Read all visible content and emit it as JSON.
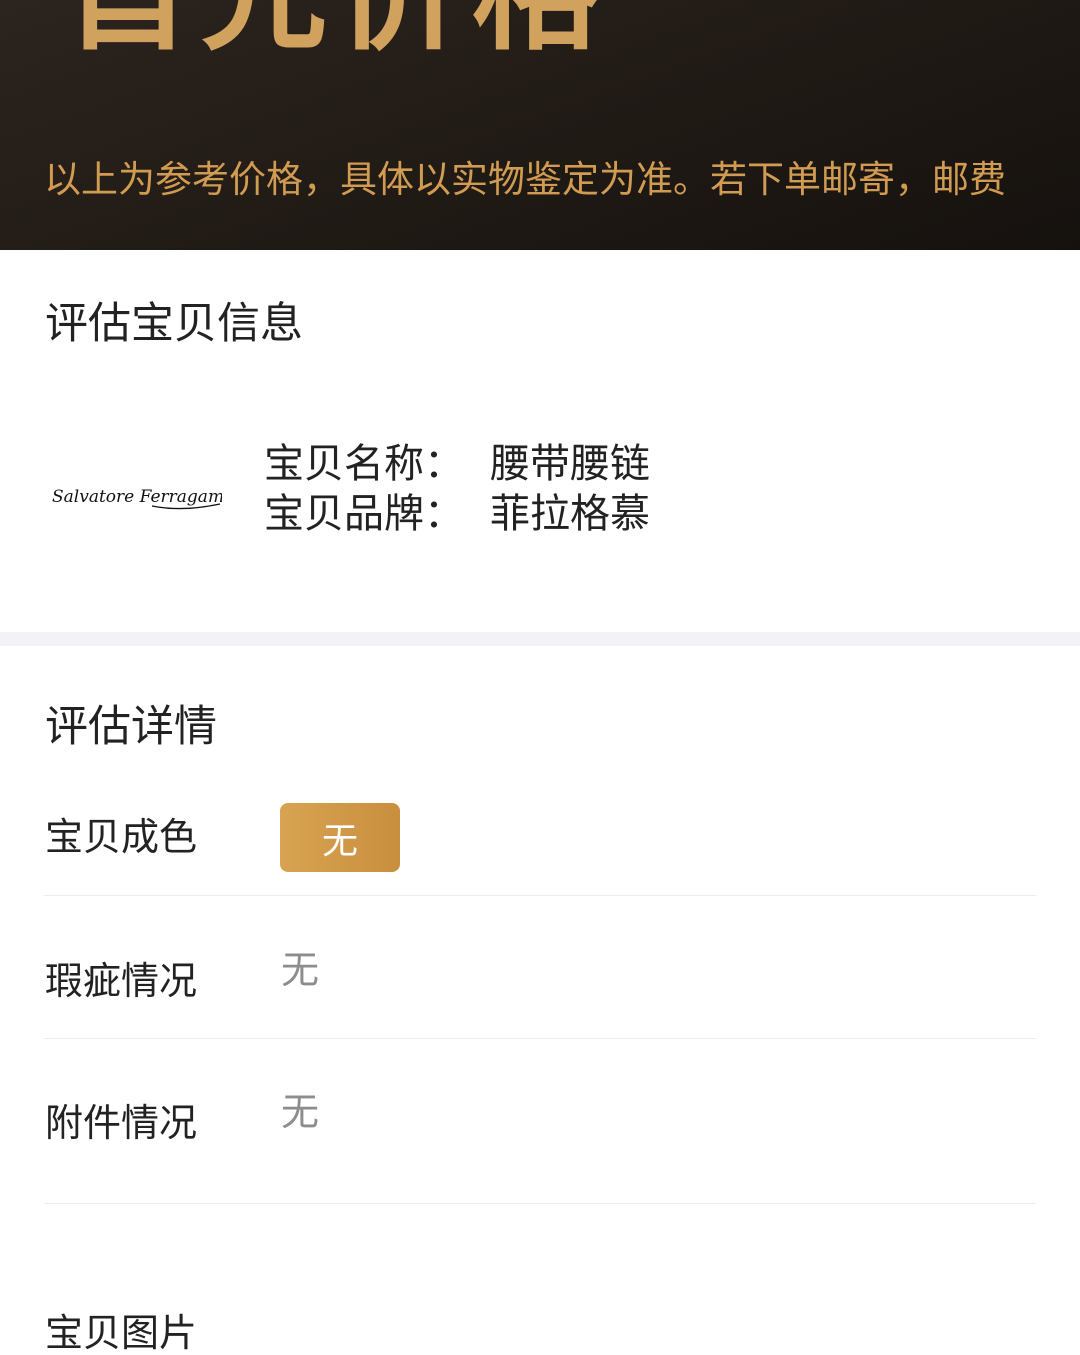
{
  "banner": {
    "big_title": "首先价格",
    "note": "以上为参考价格，具体以实物鉴定为准。若下单邮寄，邮费"
  },
  "item_info": {
    "section_title": "评估宝贝信息",
    "brand_logo_text": "Salvatore Ferragamo",
    "name_label": "宝贝名称：",
    "name_value": "腰带腰链",
    "brand_label": "宝贝品牌：",
    "brand_value": "菲拉格慕"
  },
  "details": {
    "section_title": "评估详情",
    "condition_label": "宝贝成色",
    "condition_value": "无",
    "flaw_label": "瑕疵情况",
    "flaw_value": "无",
    "accessory_label": "附件情况",
    "accessory_value": "无",
    "photos_label": "宝贝图片"
  },
  "colors": {
    "banner_bg": "#201a15",
    "gold": "#d1a25e",
    "pill": "#d0993f",
    "muted_text": "#8d8d8d"
  }
}
